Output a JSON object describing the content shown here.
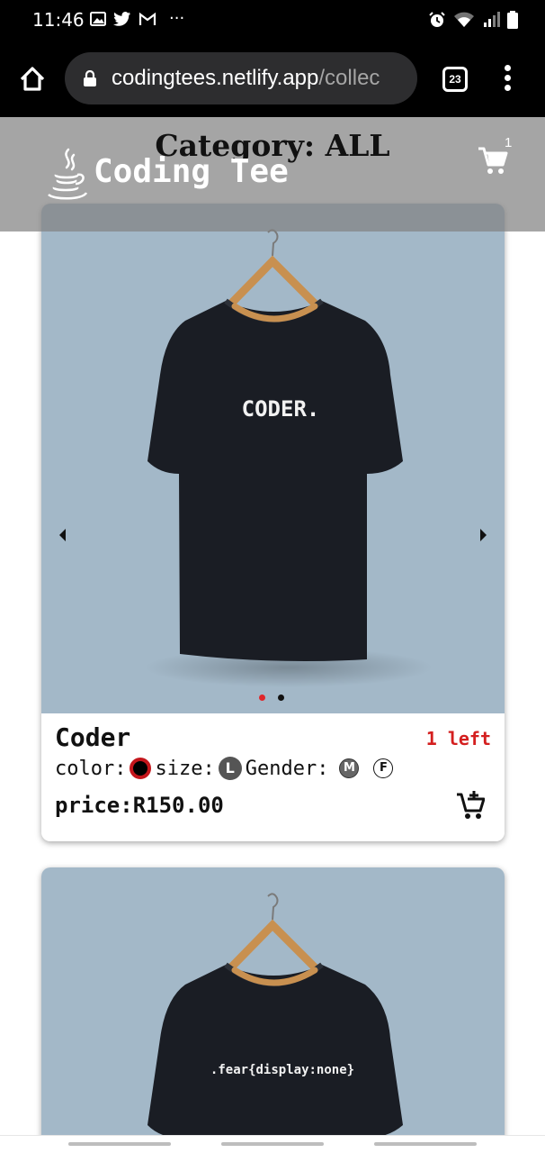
{
  "status_bar": {
    "time": "11:46",
    "left_icons": [
      "image-icon",
      "twitter-icon",
      "gmail-icon",
      "more-notifications-icon"
    ],
    "right_icons": [
      "alarm-icon",
      "wifi-icon",
      "signal-icon",
      "battery-icon"
    ]
  },
  "browser": {
    "url_main": "codingtees.netlify.app",
    "url_dim": "/collec",
    "tab_count": "23"
  },
  "header": {
    "category_title": "Category: ALL",
    "brand_name": "Coding Tee",
    "cart_count": "1"
  },
  "products": [
    {
      "name": "Coder",
      "stock": "1 left",
      "color_label": "color:",
      "size_label": "size:",
      "size_value": "L",
      "gender_label": "Gender:",
      "gender_options": [
        "M",
        "F"
      ],
      "price": "price:R150.00",
      "shirt_print": "CODER.",
      "carousel_dots": 2,
      "active_dot": 1
    },
    {
      "shirt_print": ".fear{display:none}"
    }
  ],
  "colors": {
    "card_image_bg": "#a3b8c8",
    "shirt": "#1a1d24",
    "stock_text": "#d41f1f",
    "active_dot": "#e0262a",
    "header_overlay": "#828282"
  }
}
